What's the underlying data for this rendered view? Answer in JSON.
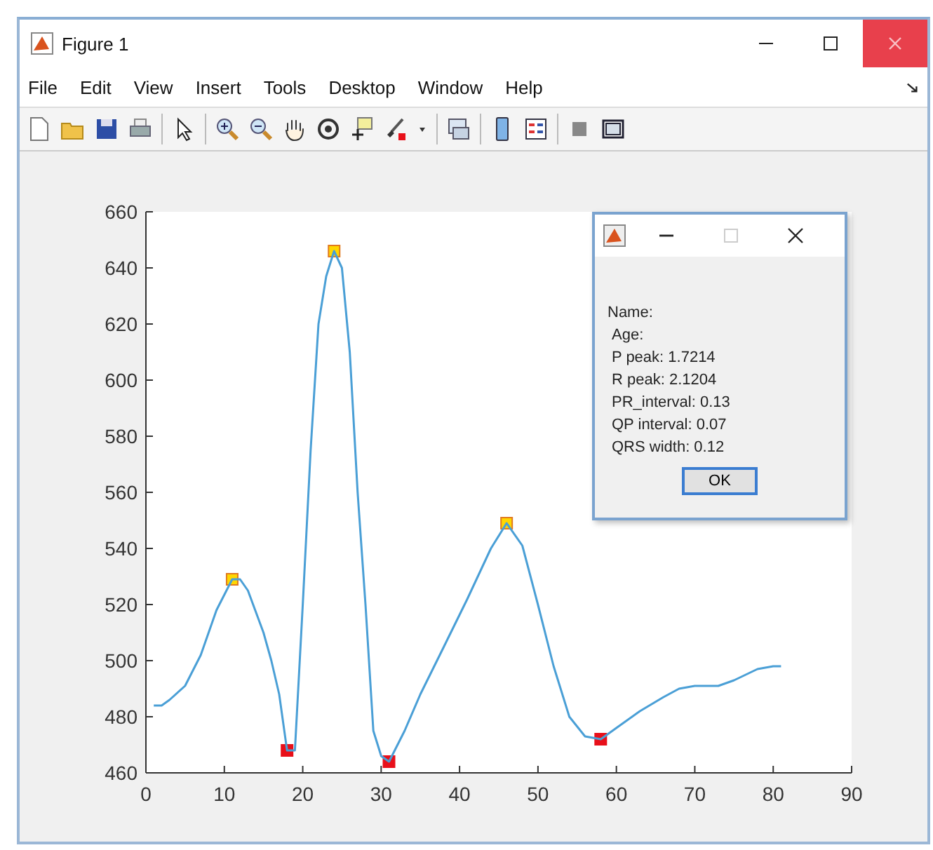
{
  "window": {
    "title": "Figure 1"
  },
  "menu": [
    "File",
    "Edit",
    "View",
    "Insert",
    "Tools",
    "Desktop",
    "Window",
    "Help"
  ],
  "chart_data": {
    "type": "line",
    "xlim": [
      0,
      90
    ],
    "ylim": [
      460,
      660
    ],
    "xticks": [
      0,
      10,
      20,
      30,
      40,
      50,
      60,
      70,
      80,
      90
    ],
    "yticks": [
      460,
      480,
      500,
      520,
      540,
      560,
      580,
      600,
      620,
      640,
      660
    ],
    "x": [
      1,
      2,
      3,
      5,
      7,
      9,
      11,
      12,
      13,
      15,
      16,
      17,
      18,
      19,
      20,
      21,
      22,
      23,
      24,
      25,
      26,
      27,
      28,
      29,
      30,
      31,
      33,
      35,
      38,
      41,
      44,
      46,
      48,
      50,
      52,
      54,
      56,
      58,
      60,
      63,
      66,
      68,
      70,
      73,
      75,
      78,
      80,
      81
    ],
    "series": [
      {
        "color": "#4a9fd6",
        "values": [
          484,
          484,
          486,
          491,
          502,
          518,
          529,
          529,
          525,
          510,
          500,
          488,
          468,
          468,
          520,
          575,
          620,
          637,
          646,
          640,
          610,
          560,
          520,
          475,
          466,
          464,
          475,
          488,
          505,
          522,
          540,
          549,
          541,
          520,
          498,
          480,
          473,
          472,
          476,
          482,
          487,
          490,
          491,
          491,
          493,
          497,
          498,
          498
        ]
      }
    ]
  },
  "dialog": {
    "lines": [
      "Name:",
      "Age:",
      "P peak: 1.7214",
      "R peak: 2.1204",
      "PR_interval: 0.13",
      "QP interval: 0.07",
      "QRS width: 0.12"
    ],
    "button": "OK"
  }
}
